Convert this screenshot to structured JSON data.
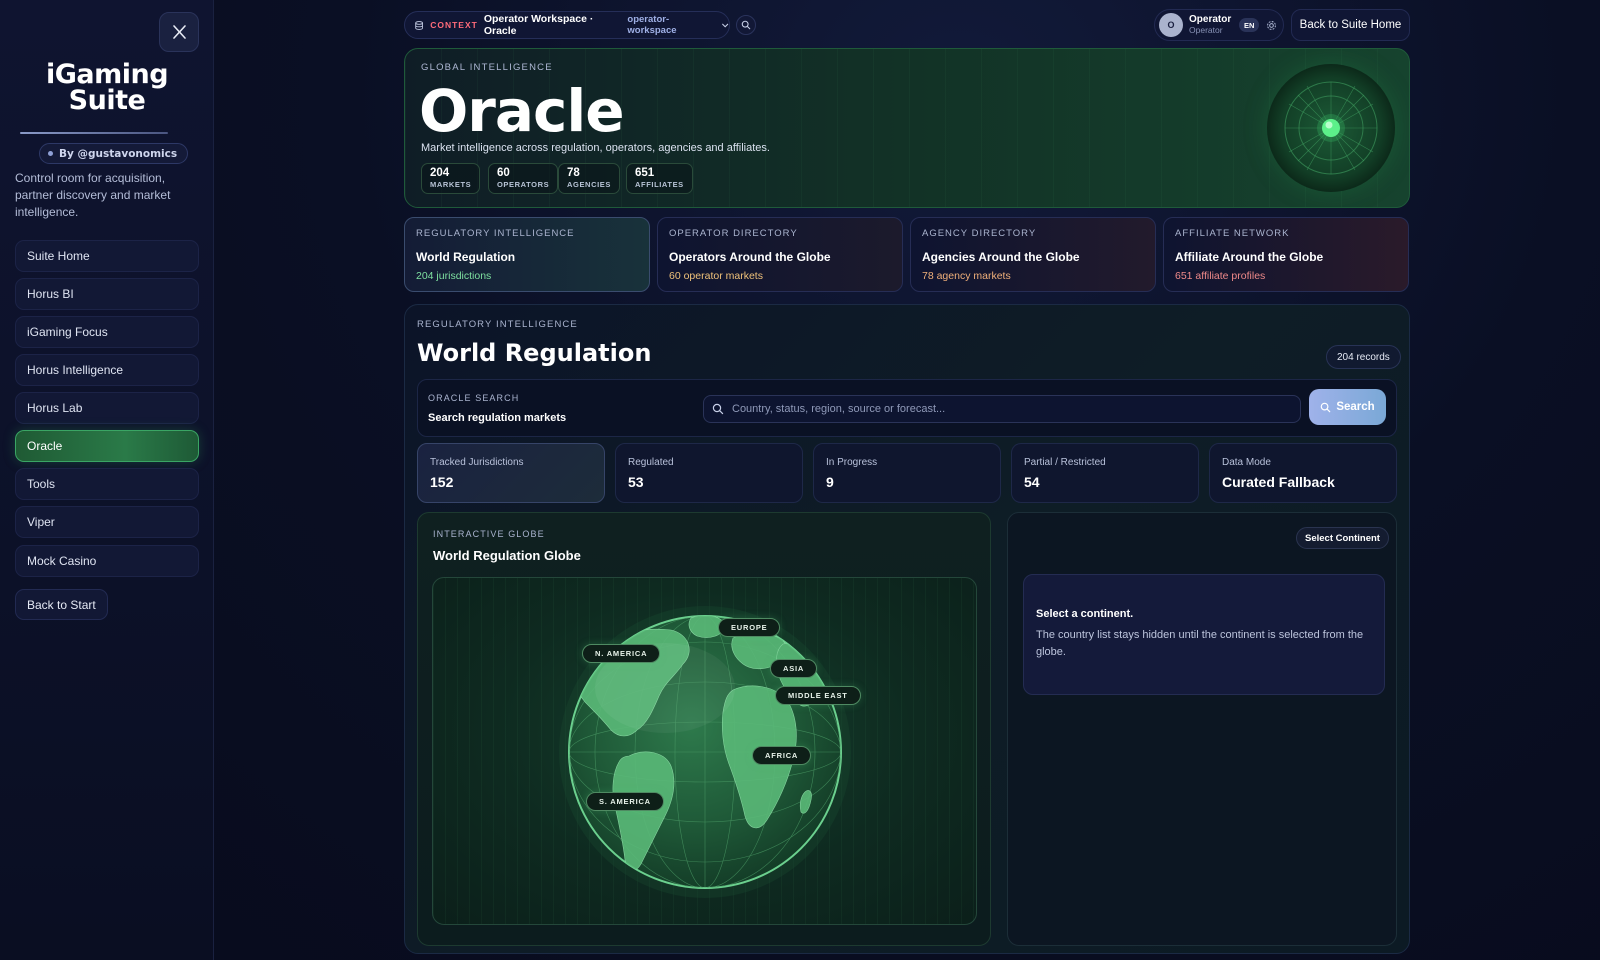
{
  "sidebar": {
    "brand_line1": "iGaming",
    "brand_line2": "Suite",
    "by_label": "By @gustavonomics",
    "tagline": "Control room for acquisition, partner discovery and market intelligence.",
    "items": [
      {
        "label": "Suite Home"
      },
      {
        "label": "Horus BI"
      },
      {
        "label": "iGaming Focus"
      },
      {
        "label": "Horus Intelligence"
      },
      {
        "label": "Horus Lab"
      },
      {
        "label": "Oracle",
        "active": true
      },
      {
        "label": "Tools"
      },
      {
        "label": "Viper"
      },
      {
        "label": "Mock Casino"
      }
    ],
    "back_to_start": "Back to Start"
  },
  "topbar": {
    "context_label": "CONTEXT",
    "context_name": "Operator Workspace · Oracle",
    "context_slug": "operator-workspace",
    "user_initial": "O",
    "user_name": "Operator",
    "user_role": "Operator",
    "language": "EN",
    "back_home": "Back to Suite Home"
  },
  "hero": {
    "kicker": "GLOBAL INTELLIGENCE",
    "title": "Oracle",
    "subtitle": "Market intelligence across regulation, operators, agencies and affiliates.",
    "stats": [
      {
        "value": "204",
        "label": "MARKETS"
      },
      {
        "value": "60",
        "label": "OPERATORS"
      },
      {
        "value": "78",
        "label": "AGENCIES"
      },
      {
        "value": "651",
        "label": "AFFILIATES"
      }
    ]
  },
  "directories": [
    {
      "kicker": "REGULATORY INTELLIGENCE",
      "title": "World Regulation",
      "count": "204 jurisdictions",
      "color": "#7ee0a0",
      "selected": true
    },
    {
      "kicker": "OPERATOR DIRECTORY",
      "title": "Operators Around the Globe",
      "count": "60 operator markets",
      "color": "#f0c27a"
    },
    {
      "kicker": "AGENCY DIRECTORY",
      "title": "Agencies Around the Globe",
      "count": "78 agency markets",
      "color": "#f0b07a"
    },
    {
      "kicker": "AFFILIATE NETWORK",
      "title": "Affiliate Around the Globe",
      "count": "651 affiliate profiles",
      "color": "#f08a8a"
    }
  ],
  "main": {
    "kicker": "REGULATORY INTELLIGENCE",
    "title": "World Regulation",
    "records": "204 records",
    "search": {
      "kicker": "ORACLE SEARCH",
      "title": "Search regulation markets",
      "placeholder": "Country, status, region, source or forecast...",
      "button": "Search"
    },
    "metrics": [
      {
        "label": "Tracked Jurisdictions",
        "value": "152"
      },
      {
        "label": "Regulated",
        "value": "53"
      },
      {
        "label": "In Progress",
        "value": "9"
      },
      {
        "label": "Partial / Restricted",
        "value": "54"
      },
      {
        "label": "Data Mode",
        "value": "Curated Fallback"
      }
    ],
    "globe": {
      "kicker": "INTERACTIVE GLOBE",
      "title": "World Regulation Globe",
      "continents": [
        "EUROPE",
        "N. AMERICA",
        "ASIA",
        "MIDDLE EAST",
        "AFRICA",
        "S. AMERICA"
      ]
    },
    "list": {
      "select_button": "Select Continent",
      "empty_title": "Select a continent.",
      "empty_desc": "The country list stays hidden until the continent is selected from the globe."
    }
  },
  "colors": {
    "accent_green": "#3aa564",
    "search_button": "#9fb2ea",
    "context_red": "#ff6b7a"
  }
}
